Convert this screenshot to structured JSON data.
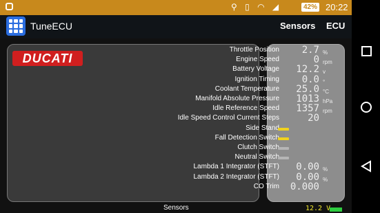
{
  "status": {
    "battery": "42%",
    "time": "20:22"
  },
  "app": {
    "title": "TuneECU",
    "tabs": [
      "Sensors",
      "ECU"
    ]
  },
  "logo_text": "DUCATI",
  "sensors": [
    {
      "label": "Throttle Position",
      "value": "2.7",
      "unit": "%"
    },
    {
      "label": "Engine Speed",
      "value": "0",
      "unit": "rpm"
    },
    {
      "label": "Battery Voltage",
      "value": "12.2",
      "unit": "v"
    },
    {
      "label": "Ignition Timing",
      "value": "0.0",
      "unit": "°"
    },
    {
      "label": "Coolant Temperature",
      "value": "25.0",
      "unit": "°C"
    },
    {
      "label": "Manifold Absolute Pressure",
      "value": "1013",
      "unit": "hPa"
    },
    {
      "label": "Idle Reference Speed",
      "value": "1357",
      "unit": "rpm"
    },
    {
      "label": "Idle Speed Control Current Steps",
      "value": "20",
      "unit": ""
    },
    {
      "label": "Side Stand",
      "indicator": "#f0d21e"
    },
    {
      "label": "Fall Detection Switch",
      "indicator": "#f0d21e"
    },
    {
      "label": "Clutch Switch",
      "indicator": "#b5b5b5"
    },
    {
      "label": "Neutral Switch",
      "indicator": "#b5b5b5"
    },
    {
      "label": "Lambda 1 Integrator (STFT)",
      "value": "0.00",
      "unit": "%"
    },
    {
      "label": "Lambda 2 Integrator (STFT)",
      "value": "0.00",
      "unit": "%"
    },
    {
      "label": "CO Trim",
      "value": "0.000",
      "unit": ""
    }
  ],
  "footer": {
    "label": "Sensors",
    "voltage": "12.2 V"
  },
  "colors": {
    "statusbar": "#c8891c",
    "accent": "#2a6de0",
    "logo": "#d01f1f",
    "voltage": "#f0e62c",
    "voltbar": "#2ecc40"
  }
}
